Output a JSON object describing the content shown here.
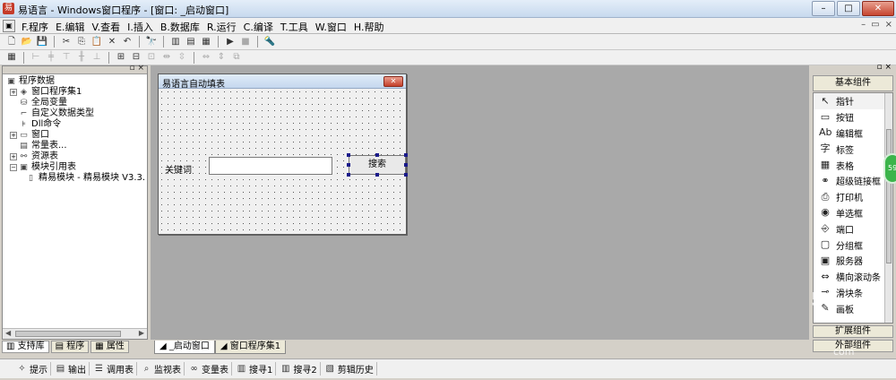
{
  "window": {
    "title": "易语言 - Windows窗口程序 - [窗口: _启动窗口]",
    "buttons": {
      "minimize": "–",
      "maximize": "□",
      "close": "✕"
    }
  },
  "menu": {
    "items": [
      "F.程序",
      "E.编辑",
      "V.查看",
      "I.插入",
      "B.数据库",
      "R.运行",
      "C.编译",
      "T.工具",
      "W.窗口",
      "H.帮助"
    ],
    "mdi_controls": {
      "minimize": "–",
      "restore": "▭",
      "close": "×"
    }
  },
  "left_panel": {
    "tree": [
      {
        "label": "程序数据",
        "icon": "folder-icon",
        "expander": "−",
        "indent": 0
      },
      {
        "label": "窗口程序集1",
        "icon": "module-icon",
        "expander": "+",
        "indent": 1
      },
      {
        "label": "全局变量",
        "icon": "variable-icon",
        "expander": "",
        "indent": 1
      },
      {
        "label": "自定义数据类型",
        "icon": "type-icon",
        "expander": "",
        "indent": 1
      },
      {
        "label": "Dll命令",
        "icon": "dll-icon",
        "expander": "",
        "indent": 1
      },
      {
        "label": "窗口",
        "icon": "window-icon",
        "expander": "+",
        "indent": 1
      },
      {
        "label": "常量表...",
        "icon": "constant-icon",
        "expander": "",
        "indent": 1
      },
      {
        "label": "资源表",
        "icon": "resource-icon",
        "expander": "+",
        "indent": 1
      },
      {
        "label": "模块引用表",
        "icon": "module-ref-icon",
        "expander": "−",
        "indent": 1
      },
      {
        "label": "精易模块 - 精易模块 V3.3.",
        "icon": "document-icon",
        "expander": "",
        "indent": 2
      }
    ],
    "tabs": [
      "支持库",
      "程序",
      "属性"
    ]
  },
  "form_designer": {
    "title": "易语言自动填表",
    "label": "关键词",
    "input_value": "",
    "button_label": "搜索"
  },
  "components": {
    "header": "基本组件",
    "items": [
      {
        "label": "指针",
        "icon": "pointer-icon",
        "glyph": "↖"
      },
      {
        "label": "按钮",
        "icon": "button-icon",
        "glyph": "▭"
      },
      {
        "label": "编辑框",
        "icon": "editbox-icon",
        "glyph": "Ab"
      },
      {
        "label": "标签",
        "icon": "label-icon",
        "glyph": "字"
      },
      {
        "label": "表格",
        "icon": "table-icon",
        "glyph": "▦"
      },
      {
        "label": "超级链接框",
        "icon": "hyperlink-icon",
        "glyph": "⚭"
      },
      {
        "label": "打印机",
        "icon": "printer-icon",
        "glyph": "⎙"
      },
      {
        "label": "单选框",
        "icon": "radio-icon",
        "glyph": "◉"
      },
      {
        "label": "端口",
        "icon": "port-icon",
        "glyph": "⎆"
      },
      {
        "label": "分组框",
        "icon": "groupbox-icon",
        "glyph": "▢"
      },
      {
        "label": "服务器",
        "icon": "server-icon",
        "glyph": "▣"
      },
      {
        "label": "横向滚动条",
        "icon": "hscroll-icon",
        "glyph": "⇔"
      },
      {
        "label": "滑块条",
        "icon": "slider-icon",
        "glyph": "⊸"
      },
      {
        "label": "画板",
        "icon": "canvas-icon",
        "glyph": "✎"
      }
    ],
    "bottom_tabs": [
      "扩展组件",
      "外部组件"
    ],
    "badge": "59"
  },
  "doc_tabs": [
    "_启动窗口",
    "窗口程序集1"
  ],
  "status_bar": [
    {
      "label": "提示",
      "icon": "tip-icon",
      "glyph": "💡"
    },
    {
      "label": "输出",
      "icon": "output-icon",
      "glyph": "▤"
    },
    {
      "label": "调用表",
      "icon": "callstack-icon",
      "glyph": "☰"
    },
    {
      "label": "监视表",
      "icon": "watch-icon",
      "glyph": "🔍"
    },
    {
      "label": "变量表",
      "icon": "variables-icon",
      "glyph": "∞"
    },
    {
      "label": "搜寻1",
      "icon": "search1-icon",
      "glyph": "▥"
    },
    {
      "label": "搜寻2",
      "icon": "search2-icon",
      "glyph": "▥"
    },
    {
      "label": "剪辑历史",
      "icon": "clip-history-icon",
      "glyph": "▧"
    }
  ],
  "watermark": {
    "big": "59",
    "small": "com"
  }
}
